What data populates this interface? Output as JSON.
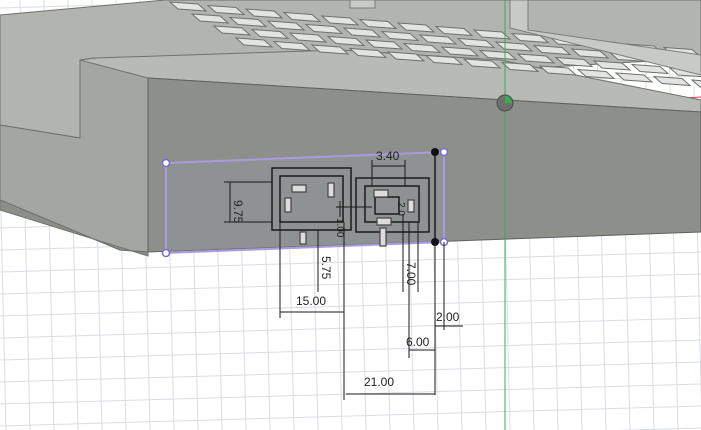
{
  "viewport": {
    "background": "#ffffff",
    "grid_color": "#d9dde3",
    "body_color": "#8f918c",
    "body_top_color": "#b4b6b2",
    "body_side_color": "#757873",
    "sketch_profile_color": "#a99be0",
    "sketch_line_color": "#1a1a1a",
    "axis_red": "#d85050",
    "axis_green": "#3aae4a"
  },
  "dimensions": {
    "width_3_40": "3.40",
    "height_9_75": "9.75",
    "offset_5_75": "5.75",
    "offset_15_00": "15.00",
    "offset_7_00": "7.00",
    "offset_2_00": "2.00",
    "offset_6_00": "6.00",
    "offset_21_00": "21.00",
    "small_1_00": "1.00",
    "small_2_0": "2.0"
  },
  "icons": {
    "origin": "origin-marker-icon",
    "constraint": "fix-constraint-icon"
  }
}
